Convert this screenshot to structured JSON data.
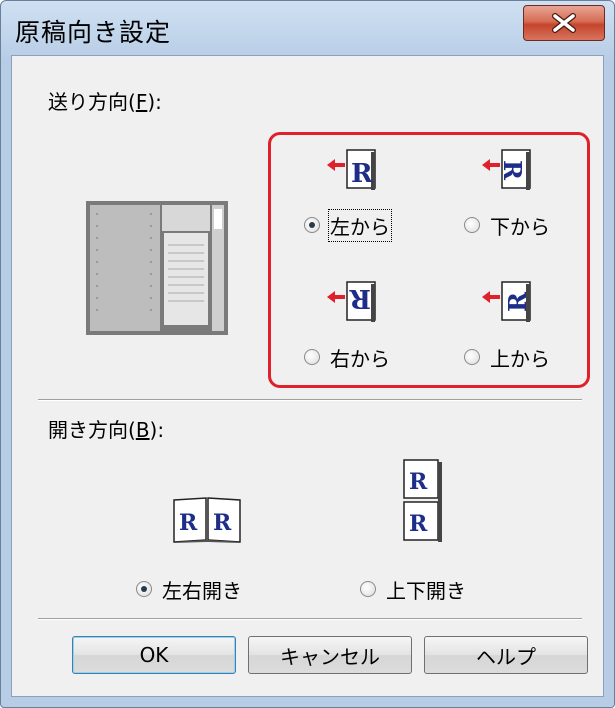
{
  "window": {
    "title": "原稿向き設定",
    "close_icon": "close-x-icon"
  },
  "feed_direction": {
    "label_prefix": "送り方向(",
    "label_key": "F",
    "label_suffix": "):",
    "options": [
      {
        "label": "左から",
        "selected": true
      },
      {
        "label": "下から",
        "selected": false
      },
      {
        "label": "右から",
        "selected": false
      },
      {
        "label": "上から",
        "selected": false
      }
    ],
    "highlight_color": "#e0202a"
  },
  "open_direction": {
    "label_prefix": "開き方向(",
    "label_key": "B",
    "label_suffix": "):",
    "options": [
      {
        "label": "左右開き",
        "selected": true
      },
      {
        "label": "上下開き",
        "selected": false
      }
    ]
  },
  "icons": {
    "page_glyph": "R"
  },
  "buttons": {
    "ok": "OK",
    "cancel": "キャンセル",
    "help": "ヘルプ"
  }
}
